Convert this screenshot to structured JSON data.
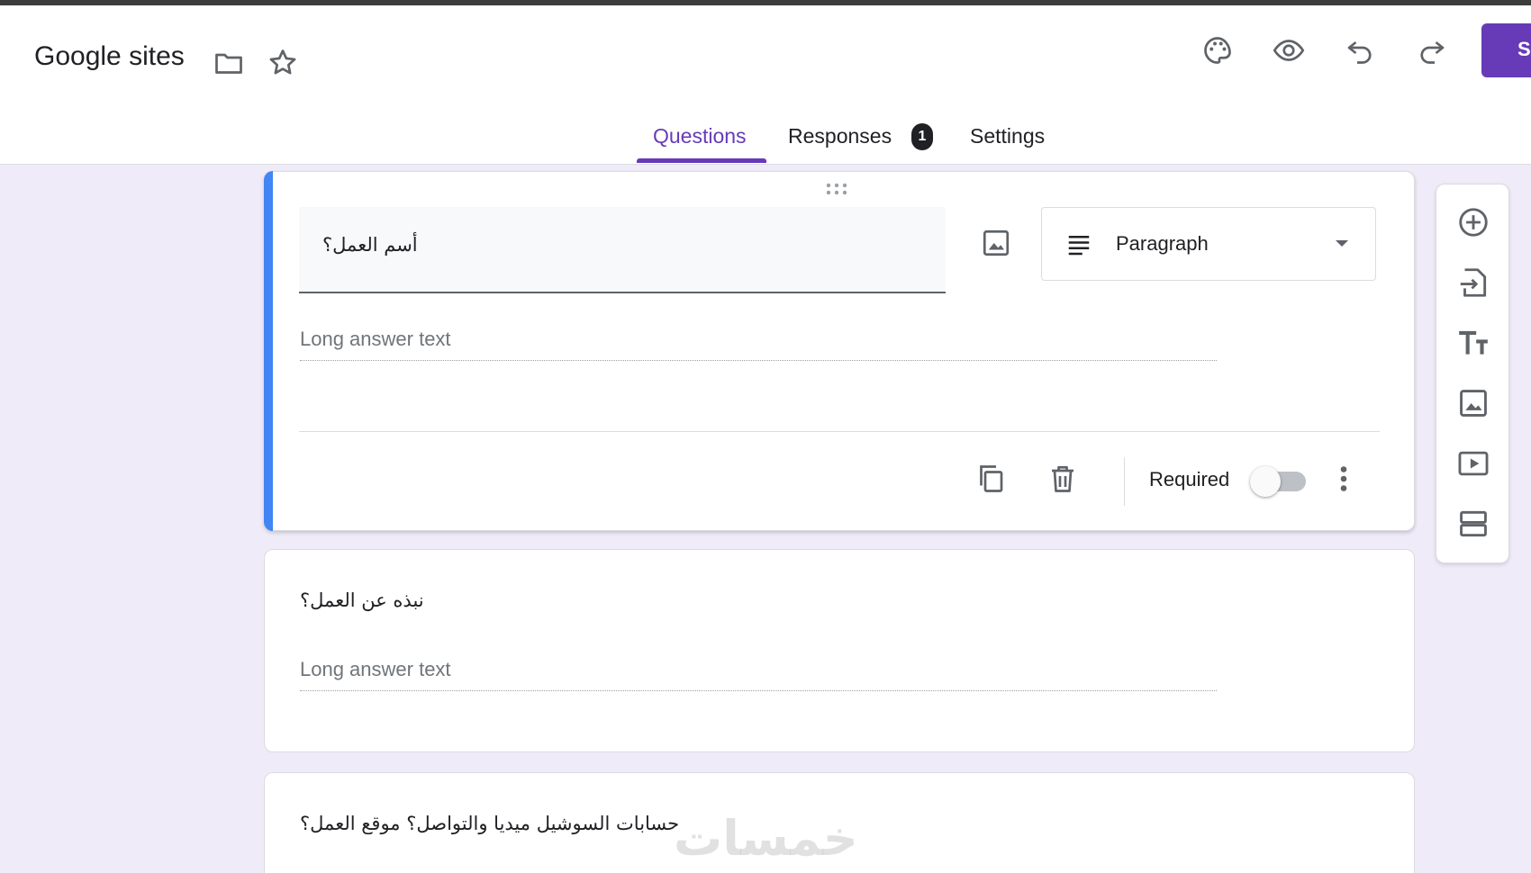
{
  "app": {
    "title": "Google sites",
    "send_label": "Send",
    "icons": [
      "folder-icon",
      "star-icon",
      "palette-icon",
      "eye-icon",
      "undo-icon",
      "redo-icon"
    ]
  },
  "tabs": [
    {
      "label": "Questions",
      "active": true
    },
    {
      "label": "Responses",
      "badge": "1"
    },
    {
      "label": "Settings"
    }
  ],
  "questions": [
    {
      "title": "أسم العمل؟",
      "type": "Paragraph",
      "answer_placeholder": "Long answer text",
      "required_label": "Required",
      "required": false,
      "active": true
    },
    {
      "title": "نبذه عن العمل؟",
      "answer_placeholder": "Long answer text"
    },
    {
      "title": "حسابات السوشيل ميديا والتواصل؟  موقع العمل؟"
    }
  ],
  "sidebar": {
    "icons": [
      "add-question-icon",
      "import-questions-icon",
      "add-title-icon",
      "add-image-icon",
      "add-video-icon",
      "add-section-icon"
    ]
  },
  "watermark": "خمسات",
  "colors": {
    "accent": "#673ab7",
    "page_bg": "#f0ebf8",
    "active_card_bar": "#4285f4"
  }
}
